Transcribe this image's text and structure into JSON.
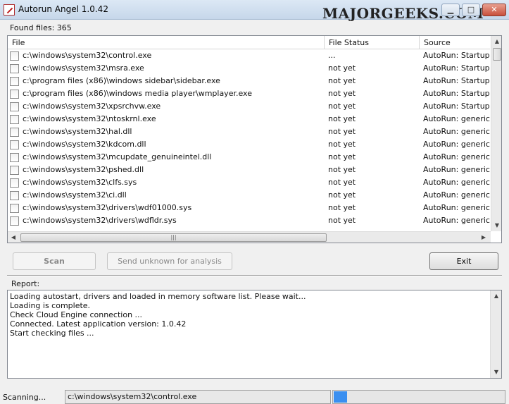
{
  "window": {
    "title": "Autorun Angel 1.0.42",
    "watermark": "MAJORGEEKS.COM"
  },
  "found_files": "Found files: 365",
  "grid": {
    "columns": [
      "File",
      "File Status",
      "Source"
    ],
    "rows": [
      {
        "file": "c:\\windows\\system32\\control.exe",
        "status": "...",
        "source": "AutoRun:  Startup f"
      },
      {
        "file": "c:\\windows\\system32\\msra.exe",
        "status": "not yet",
        "source": "AutoRun:  Startup f"
      },
      {
        "file": "c:\\program files (x86)\\windows sidebar\\sidebar.exe",
        "status": "not yet",
        "source": "AutoRun:  Startup f"
      },
      {
        "file": "c:\\program files (x86)\\windows media player\\wmplayer.exe",
        "status": "not yet",
        "source": "AutoRun:  Startup f"
      },
      {
        "file": "c:\\windows\\system32\\xpsrchvw.exe",
        "status": "not yet",
        "source": "AutoRun:  Startup f"
      },
      {
        "file": "c:\\windows\\system32\\ntoskrnl.exe",
        "status": "not yet",
        "source": "AutoRun:  generic"
      },
      {
        "file": "c:\\windows\\system32\\hal.dll",
        "status": "not yet",
        "source": "AutoRun:  generic"
      },
      {
        "file": "c:\\windows\\system32\\kdcom.dll",
        "status": "not yet",
        "source": "AutoRun:  generic"
      },
      {
        "file": "c:\\windows\\system32\\mcupdate_genuineintel.dll",
        "status": "not yet",
        "source": "AutoRun:  generic"
      },
      {
        "file": "c:\\windows\\system32\\pshed.dll",
        "status": "not yet",
        "source": "AutoRun:  generic"
      },
      {
        "file": "c:\\windows\\system32\\clfs.sys",
        "status": "not yet",
        "source": "AutoRun:  generic"
      },
      {
        "file": "c:\\windows\\system32\\ci.dll",
        "status": "not yet",
        "source": "AutoRun:  generic"
      },
      {
        "file": "c:\\windows\\system32\\drivers\\wdf01000.sys",
        "status": "not yet",
        "source": "AutoRun:  generic"
      },
      {
        "file": "c:\\windows\\system32\\drivers\\wdfldr.sys",
        "status": "not yet",
        "source": "AutoRun:  generic"
      }
    ]
  },
  "buttons": {
    "scan": "Scan",
    "send_unknown": "Send unknown for analysis",
    "exit": "Exit"
  },
  "report": {
    "label": "Report:",
    "lines": [
      "Loading autostart, drivers and loaded in memory software list. Please wait...",
      "Loading is complete.",
      "Check Cloud Engine connection ...",
      "Connected. Latest application version: 1.0.42",
      "Start checking files ..."
    ]
  },
  "status_bar": {
    "label": "Scanning...",
    "current_path": "c:\\windows\\system32\\control.exe",
    "progress_fraction": 0.08
  },
  "colors": {
    "progress": "#3a8ff0",
    "window_bg": "#f0f0f0"
  }
}
